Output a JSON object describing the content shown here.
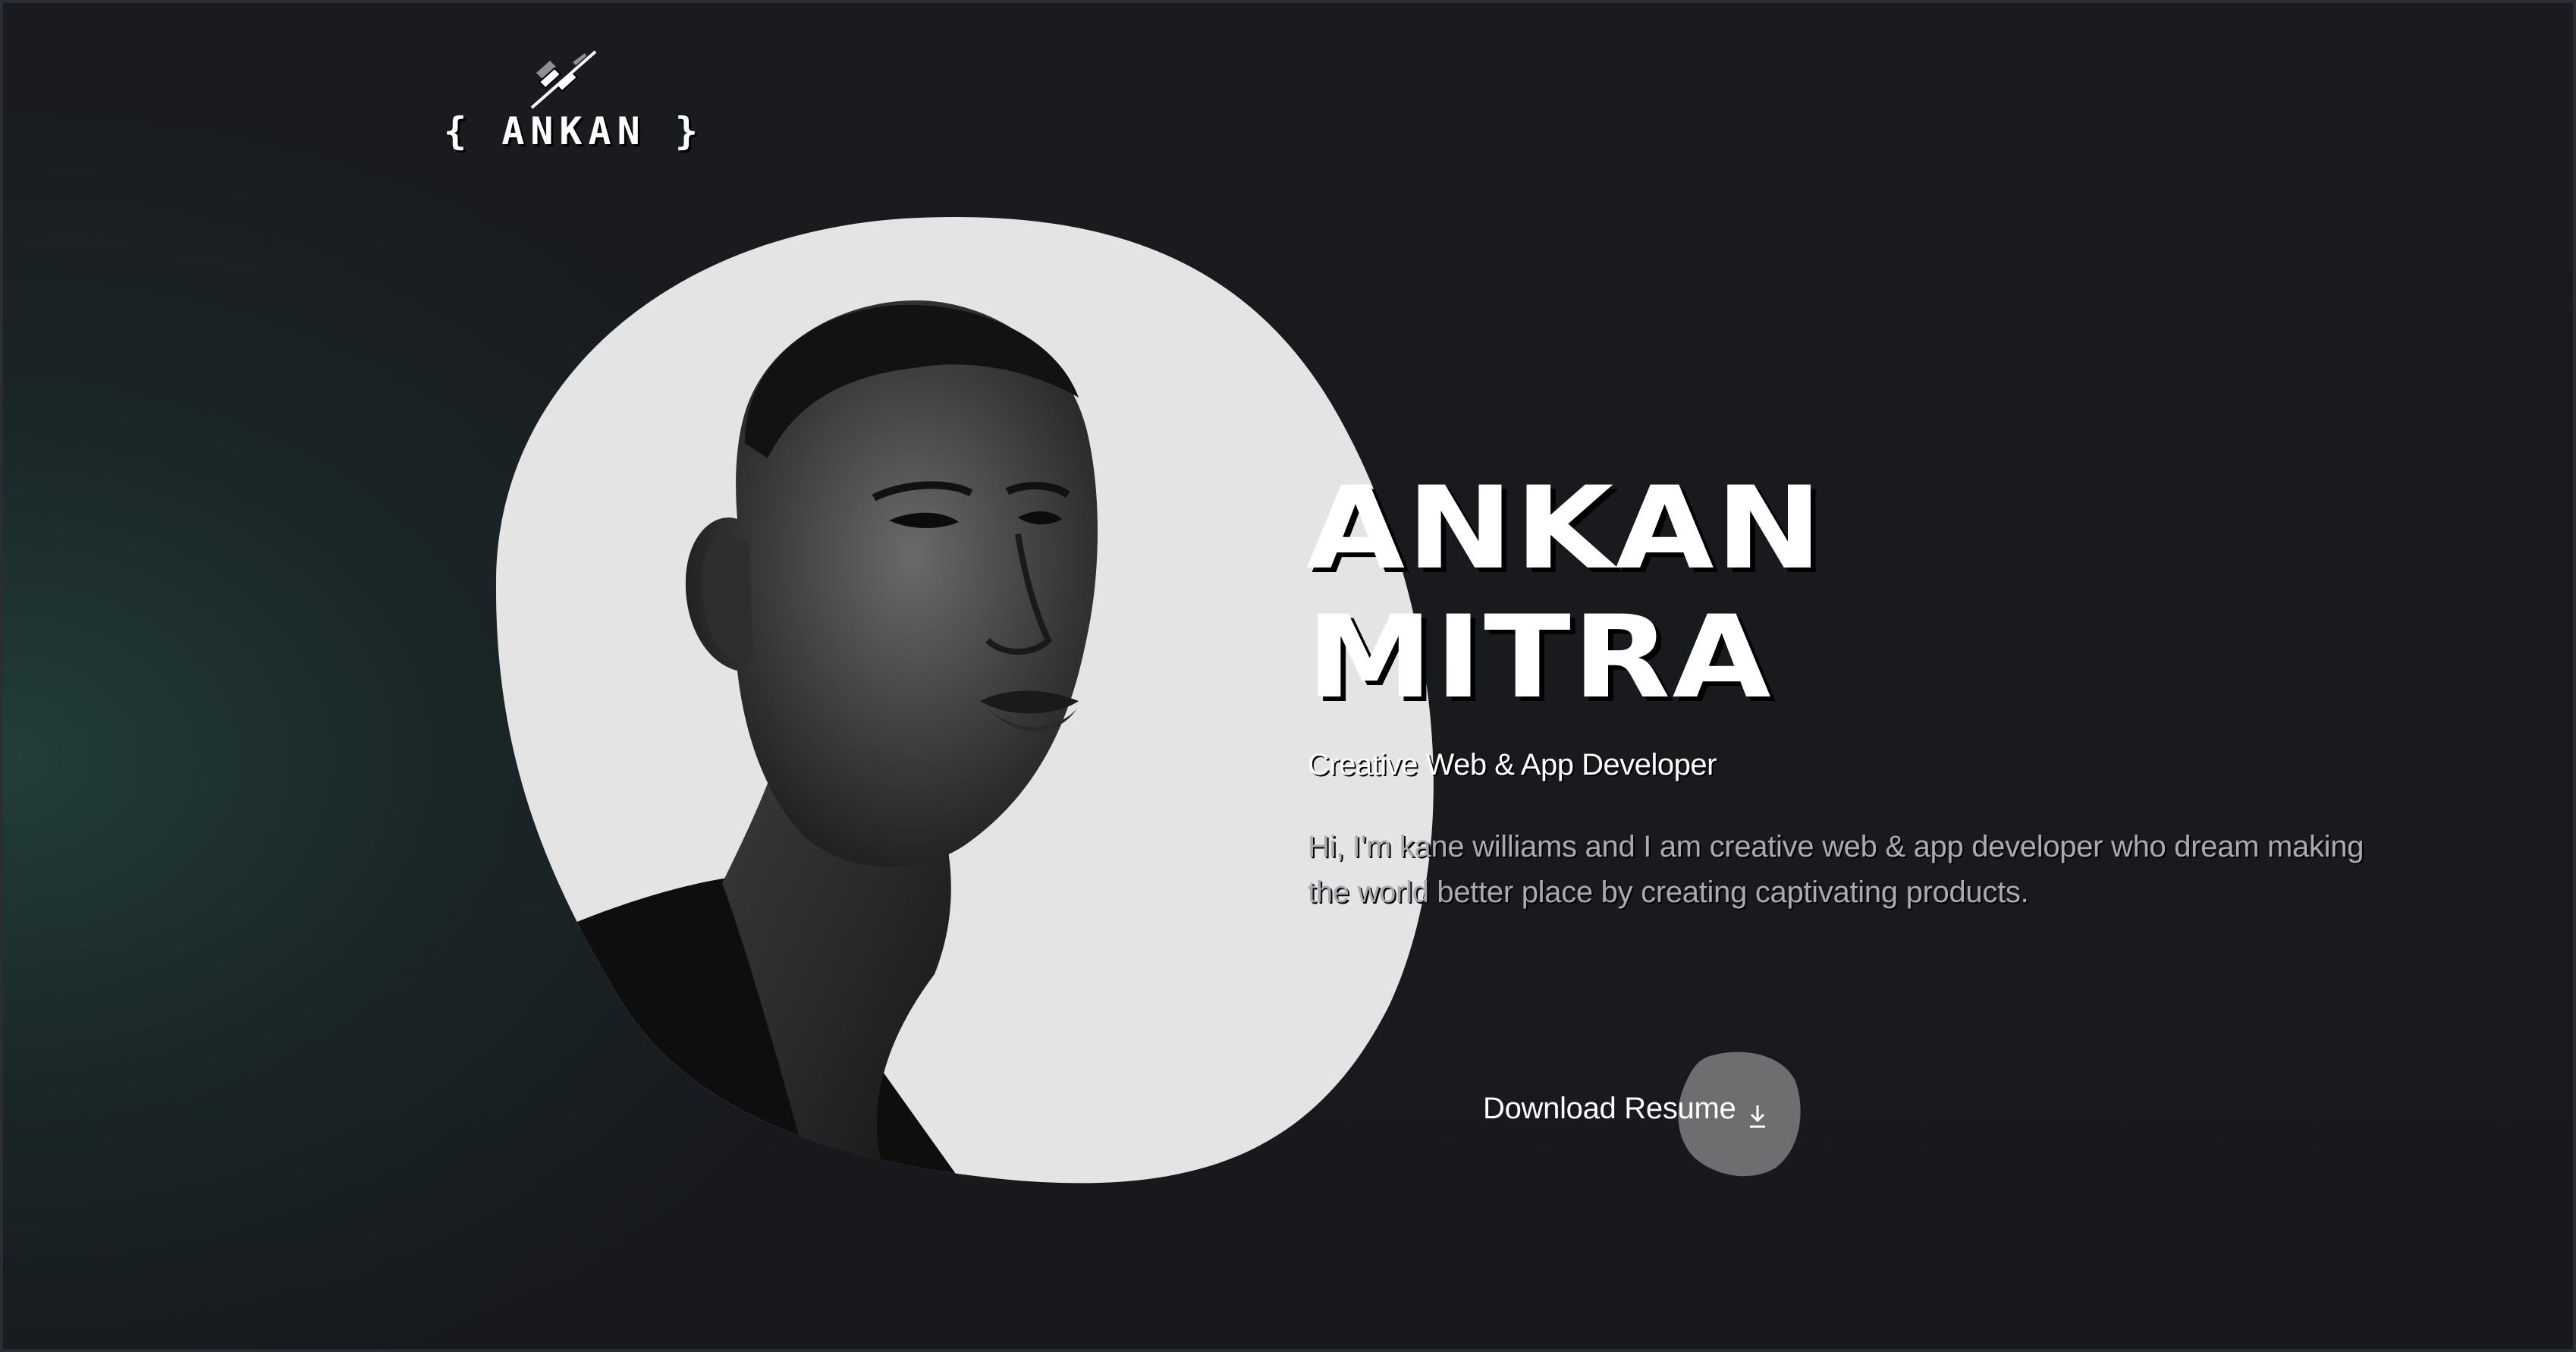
{
  "logo": {
    "text": "{ ANKAN }",
    "icon": "logo-mark-icon"
  },
  "hero": {
    "name_line1": "ANKAN",
    "name_line2": "MITRA",
    "role": "Creative Web & App Developer",
    "bio": "Hi, I'm kane williams and I am creative web & app developer who dream making the world better place by creating captivating products."
  },
  "cta": {
    "download_label": "Download Resume",
    "icon": "download-icon"
  },
  "colors": {
    "background": "#17191d",
    "accent_glow": "#24443f",
    "text_primary": "#ffffff",
    "text_secondary": "#a9abb0",
    "portrait_blob": "#e4e4e4",
    "button_blob": "#6e6e70"
  }
}
